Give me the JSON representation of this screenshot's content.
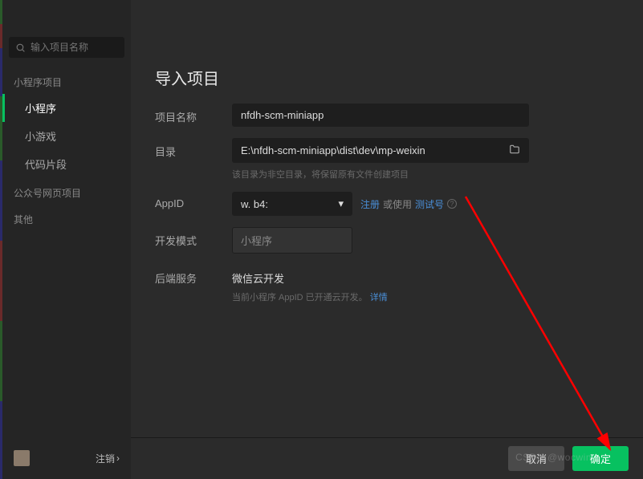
{
  "titlebar": {
    "settings": "settings-icon",
    "close": "close-icon"
  },
  "sidebar": {
    "search_placeholder": "输入项目名称",
    "sections": [
      {
        "label": "小程序项目",
        "items": [
          "小程序",
          "小游戏",
          "代码片段"
        ],
        "active": 0
      },
      {
        "label": "公众号网页项目",
        "items": []
      },
      {
        "label": "其他",
        "items": []
      }
    ],
    "logout": "注销"
  },
  "page": {
    "title": "导入项目"
  },
  "form": {
    "name": {
      "label": "项目名称",
      "value": "nfdh-scm-miniapp"
    },
    "dir": {
      "label": "目录",
      "value": "E:\\nfdh-scm-miniapp\\dist\\dev\\mp-weixin",
      "hint": "该目录为非空目录，将保留原有文件创建项目"
    },
    "appid": {
      "label": "AppID",
      "value": "w.              b4:",
      "register_link": "注册",
      "or_use": "或使用",
      "test_link": "测试号"
    },
    "mode": {
      "label": "开发模式",
      "value": "小程序"
    },
    "service": {
      "label": "后端服务",
      "value": "微信云开发",
      "hint_prefix": "当前小程序 AppID 已开通云开发。",
      "details_link": "详情"
    }
  },
  "footer": {
    "cancel": "取消",
    "confirm": "确定"
  },
  "watermark": "CSDN @wocwin"
}
